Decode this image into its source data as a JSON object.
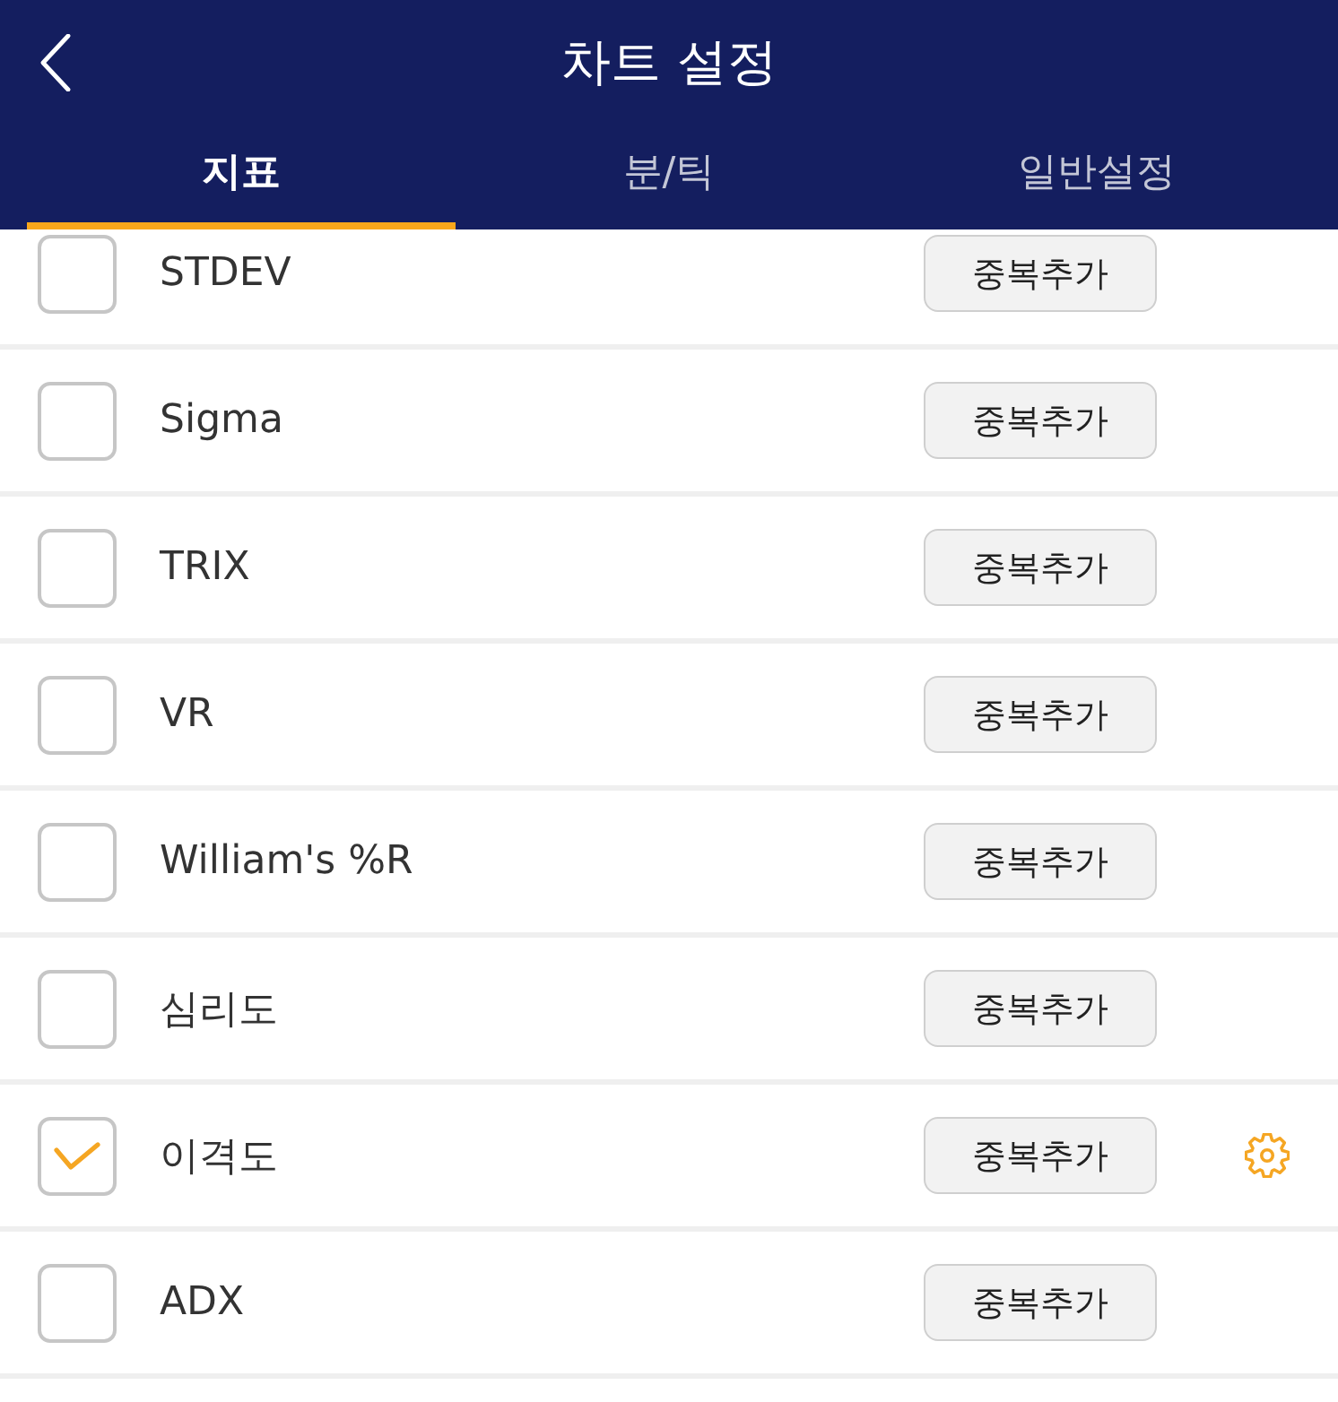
{
  "header": {
    "title": "차트 설정"
  },
  "tabs": [
    {
      "label": "지표",
      "selected": true
    },
    {
      "label": "분/틱",
      "selected": false
    },
    {
      "label": "일반설정",
      "selected": false
    }
  ],
  "indicators": [
    {
      "name": "STDEV",
      "checked": false,
      "button": "중복추가"
    },
    {
      "name": "Sigma",
      "checked": false,
      "button": "중복추가"
    },
    {
      "name": "TRIX",
      "checked": false,
      "button": "중복추가"
    },
    {
      "name": "VR",
      "checked": false,
      "button": "중복추가"
    },
    {
      "name": "William's %R",
      "checked": false,
      "button": "중복추가"
    },
    {
      "name": "심리도",
      "checked": false,
      "button": "중복추가"
    },
    {
      "name": "이격도",
      "checked": true,
      "button": "중복추가"
    },
    {
      "name": "ADX",
      "checked": false,
      "button": "중복추가"
    }
  ]
}
